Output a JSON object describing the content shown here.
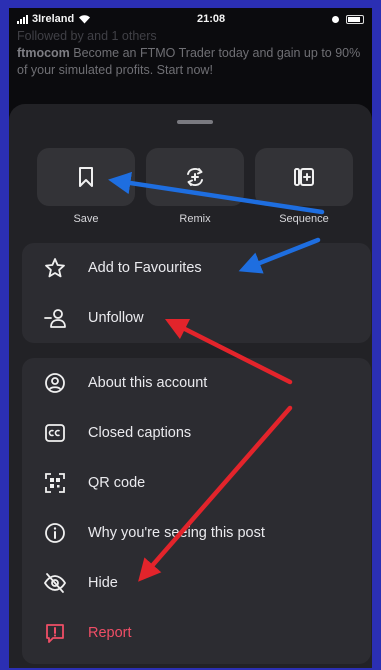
{
  "status_bar": {
    "carrier": "3Ireland",
    "time": "21:08"
  },
  "background_post": {
    "followed_line": "Followed by and 1 others",
    "author": "ftmocom",
    "text": "Become an FTMO Trader today and gain up to 90% of your simulated profits. Start now!"
  },
  "top_actions": [
    {
      "label": "Save",
      "icon": "bookmark-icon"
    },
    {
      "label": "Remix",
      "icon": "remix-icon"
    },
    {
      "label": "Sequence",
      "icon": "sequence-icon"
    }
  ],
  "menu_group_1": [
    {
      "label": "Add to Favourites",
      "icon": "star-icon"
    },
    {
      "label": "Unfollow",
      "icon": "unfollow-icon"
    }
  ],
  "menu_group_2": [
    {
      "label": "About this account",
      "icon": "account-icon"
    },
    {
      "label": "Closed captions",
      "icon": "captions-icon"
    },
    {
      "label": "QR code",
      "icon": "qr-icon"
    },
    {
      "label": "Why you're seeing this post",
      "icon": "info-icon"
    },
    {
      "label": "Hide",
      "icon": "hide-icon"
    },
    {
      "label": "Report",
      "icon": "report-icon"
    }
  ],
  "colors": {
    "frame_background": "#2b2fb3",
    "sheet": "#222226",
    "group": "#2c2c31",
    "report": "#ef4e66",
    "blue_arrow": "#1e6ee0",
    "red_arrow": "#e3242b"
  }
}
